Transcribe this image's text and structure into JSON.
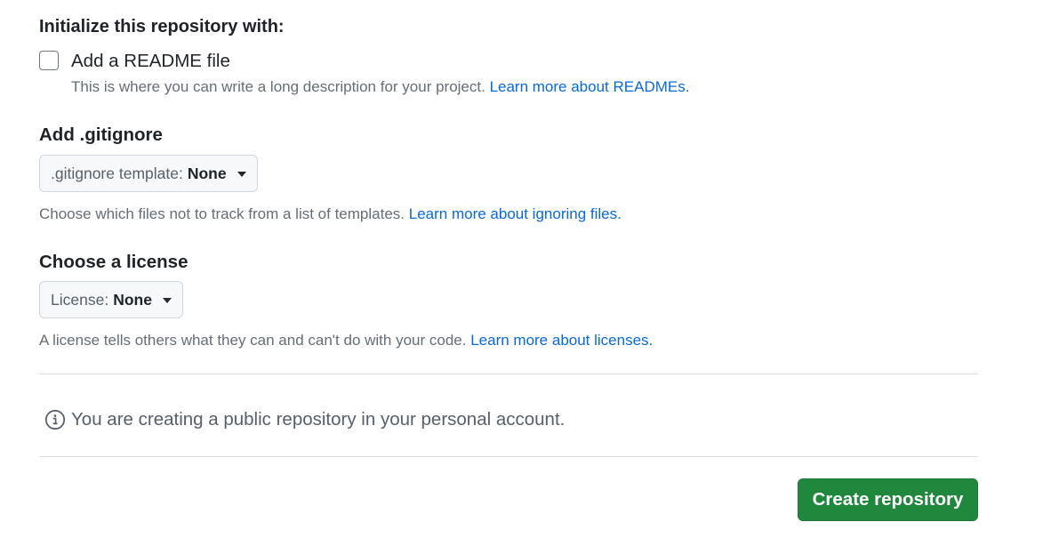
{
  "init": {
    "heading": "Initialize this repository with:"
  },
  "readme": {
    "label": "Add a README file",
    "description": "This is where you can write a long description for your project.",
    "link": "Learn more about READMEs.",
    "checked": false
  },
  "gitignore": {
    "heading": "Add .gitignore",
    "dropdown_prefix": ".gitignore template:",
    "dropdown_value": "None",
    "help": "Choose which files not to track from a list of templates.",
    "link": "Learn more about ignoring files."
  },
  "license": {
    "heading": "Choose a license",
    "dropdown_prefix": "License:",
    "dropdown_value": "None",
    "help": "A license tells others what they can and can't do with your code.",
    "link": "Learn more about licenses."
  },
  "notice": {
    "icon": "info-icon",
    "text": "You are creating a public repository in your personal account."
  },
  "actions": {
    "create_label": "Create repository"
  },
  "colors": {
    "primary_button": "#1f883d",
    "link": "#0969da"
  }
}
